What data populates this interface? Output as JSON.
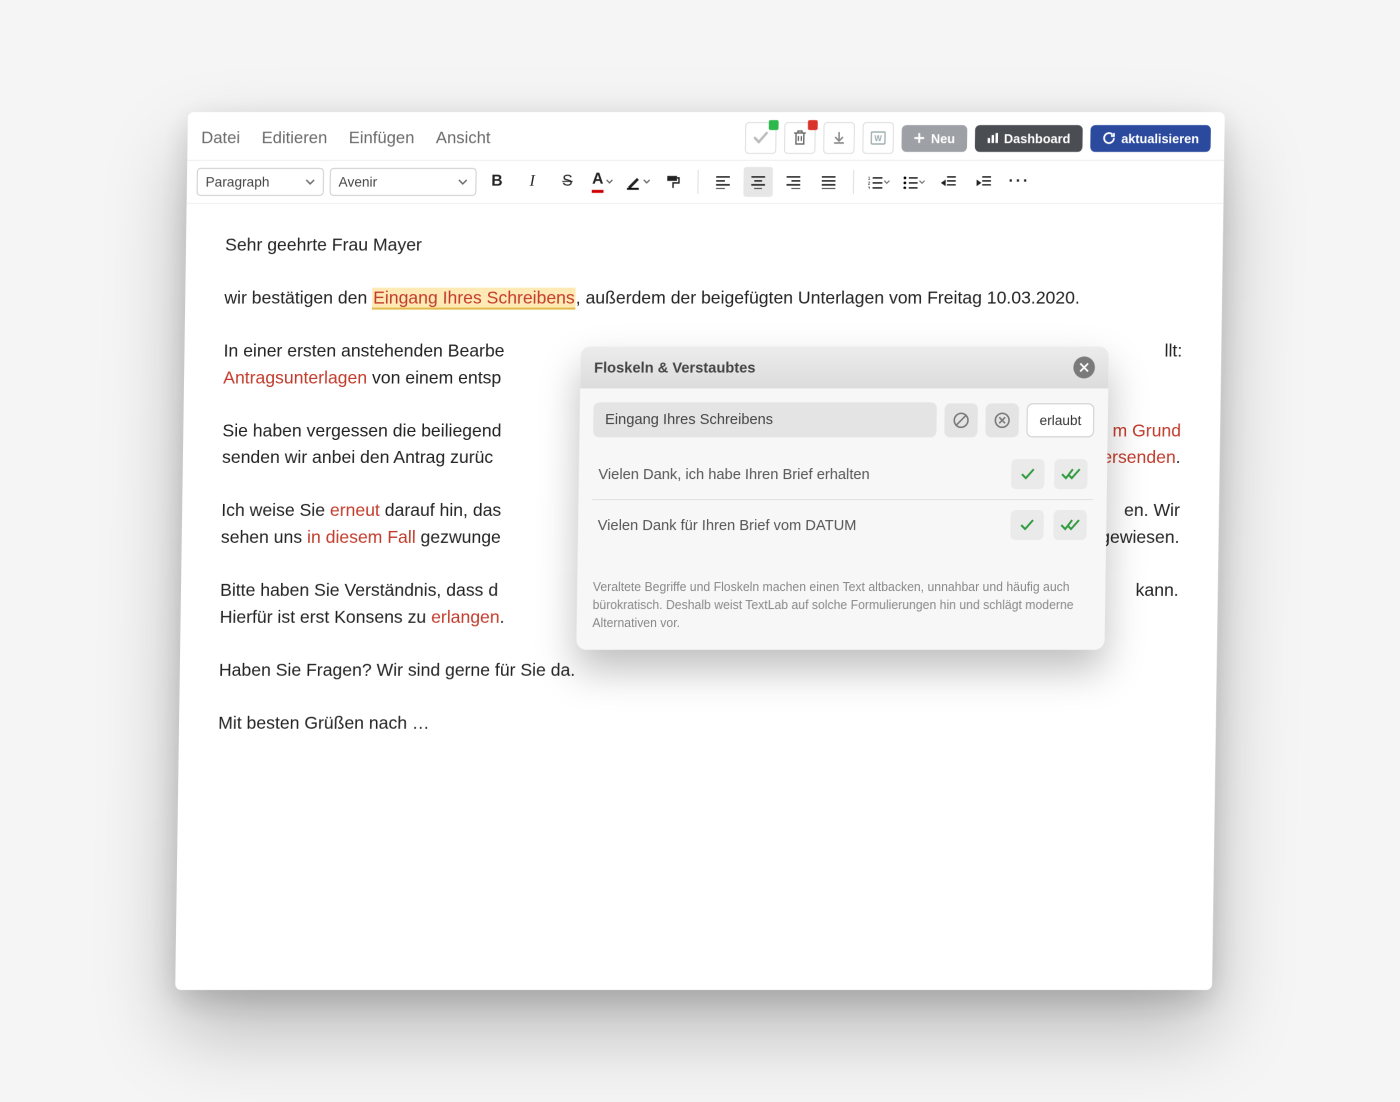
{
  "menu": {
    "items": [
      "Datei",
      "Editieren",
      "Einfügen",
      "Ansicht"
    ],
    "buttons": {
      "new": "Neu",
      "dashboard": "Dashboard",
      "refresh": "aktualisieren"
    }
  },
  "formatbar": {
    "style": "Paragraph",
    "font": "Avenir"
  },
  "doc": {
    "greeting": "Sehr geehrte Frau Mayer",
    "p1_a": "wir bestätigen den ",
    "p1_hl": "Eingang Ihres Schreibens",
    "p1_b": ", außerdem der beigefügten Unterlagen vom Freitag 10.03.2020.",
    "p2_a": "In einer ersten anstehenden Bearbe",
    "p2_tail": "llt:",
    "p2_flag": "Antragsunterlagen",
    "p2_b": " von einem entsp",
    "p3_a": "Sie haben vergessen die beiliegend",
    "p3_tail1": "m Grund",
    "p3_b": "senden wir anbei den Antrag zurüc",
    "p3_flag": "übersenden",
    "p3_dot": ".",
    "p4_a": "Ich weise Sie ",
    "p4_flag1": "erneut",
    "p4_b": " darauf hin, das",
    "p4_tail1": "en. Wir",
    "p4_c": "sehen uns ",
    "p4_flag2": "in diesem Fall",
    "p4_d": " gezwunge",
    "p4_tail2": "ingewiesen.",
    "p5_a": "Bitte haben Sie Verständnis, dass d",
    "p5_tail": " kann.",
    "p5_b": "Hierfür ist erst Konsens zu ",
    "p5_flag": "erlangen",
    "p5_dot": ".",
    "p6": "Haben Sie Fragen? Wir sind gerne für Sie da.",
    "p7": "Mit besten Grüßen nach …"
  },
  "popup": {
    "title": "Floskeln & Verstaubtes",
    "phrase": "Eingang Ihres Schreibens",
    "allow": "erlaubt",
    "suggestions": [
      "Vielen Dank, ich habe Ihren Brief erhalten",
      "Vielen Dank für Ihren Brief vom DATUM"
    ],
    "footer": "Veraltete Begriffe und Floskeln machen einen Text altbacken, unnahbar und häufig auch bürokratisch. Deshalb weist TextLab auf solche Formulierungen hin und schlägt moderne Alternativen vor."
  }
}
